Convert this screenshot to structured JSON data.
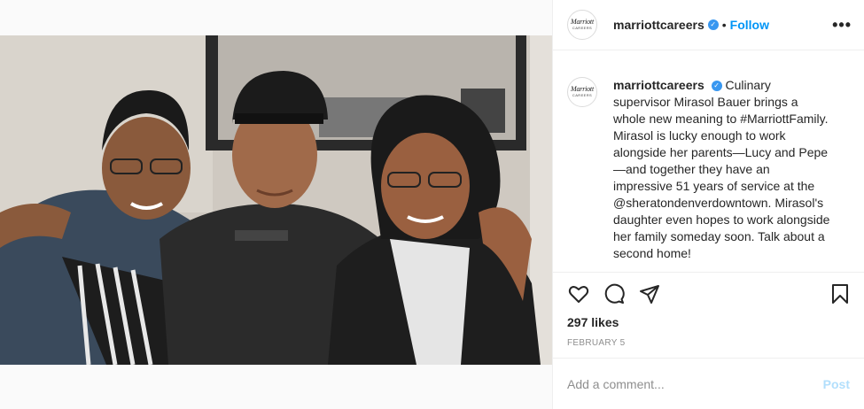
{
  "post": {
    "image_alt": "Three people seated together smiling",
    "logo_text": "Marriott",
    "logo_subtext": "CAREERS"
  },
  "header": {
    "username": "marriottcareers",
    "separator": "•",
    "follow_label": "Follow",
    "more_icon": "more-options-icon"
  },
  "caption": {
    "username": "marriottcareers",
    "text": "Culinary supervisor Mirasol Bauer brings a whole new meaning to #MarriottFamily. Mirasol is lucky enough to work alongside her parents—Lucy and Pepe—and together they have an impressive 51 years of service at the @sheratondenverdowntown. Mirasol's daughter even hopes to work alongside her family someday soon. Talk about a second home!"
  },
  "actions": {
    "icons": [
      "heart-icon",
      "comment-icon",
      "share-icon",
      "bookmark-icon"
    ],
    "likes": "297 likes",
    "date": "FEBRUARY 5"
  },
  "comment": {
    "placeholder": "Add a comment...",
    "post_label": "Post"
  },
  "colors": {
    "accent": "#0095f6",
    "verified": "#3897f0",
    "post_disabled": "#b2dffc",
    "text": "#262626",
    "muted": "#8e8e8e"
  }
}
